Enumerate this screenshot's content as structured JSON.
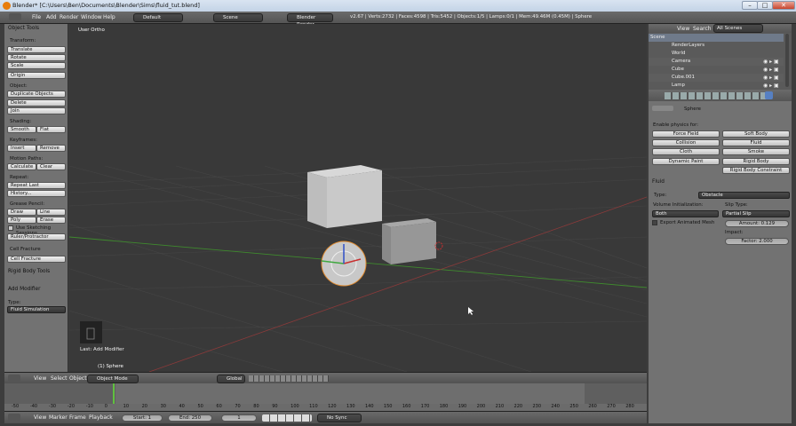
{
  "window": {
    "title": "Blender* [C:\\Users\\Ben\\Documents\\Blender\\Sims\\fluid_tut.blend]",
    "min": "–",
    "max": "□",
    "close": "✕"
  },
  "info_header": {
    "menus": [
      "File",
      "Add",
      "Render",
      "Window",
      "Help"
    ],
    "screen_layout": "Default",
    "scene": "Scene",
    "engine": "Blender Render",
    "stats": "v2.67 | Verts:2732 | Faces:4598 | Tris:5452 | Objects:1/5 | Lamps:0/1 | Mem:49.46M (0.45M) | Sphere"
  },
  "tool_shelf": {
    "title": "Object Tools",
    "transform_label": "Transform:",
    "translate": "Translate",
    "rotate": "Rotate",
    "scale": "Scale",
    "origin": "Origin",
    "object_label": "Object:",
    "duplicate": "Duplicate Objects",
    "delete": "Delete",
    "join": "Join",
    "shading_label": "Shading:",
    "smooth": "Smooth",
    "flat": "Flat",
    "keyframes_label": "Keyframes:",
    "insert": "Insert",
    "remove": "Remove",
    "motion_label": "Motion Paths:",
    "calculate": "Calculate",
    "clear": "Clear",
    "repeat_label": "Repeat:",
    "repeat_last": "Repeat Last",
    "history": "History...",
    "grease_label": "Grease Pencil:",
    "draw": "Draw",
    "line": "Line",
    "poly": "Poly",
    "erase": "Erase",
    "sketching": "Use Sketching Sessions",
    "ruler": "Ruler/Protractor",
    "cell_label": "Cell Fracture",
    "cell_btn": "Cell Fracture",
    "rigid_body": "Rigid Body Tools",
    "add_modifier": "Add Modifier",
    "type_label": "Type:",
    "type_value": "Fluid Simulation"
  },
  "viewport": {
    "label": "User Ortho",
    "last_op": "Last: Add Modifier",
    "active_obj": "(1) Sphere"
  },
  "view_header": {
    "menus": [
      "View",
      "Select",
      "Object"
    ],
    "mode": "Object Mode",
    "orientation": "Global"
  },
  "timeline": {
    "ticks": [
      "-50",
      "-40",
      "-30",
      "-20",
      "-10",
      "0",
      "10",
      "20",
      "30",
      "40",
      "50",
      "60",
      "70",
      "80",
      "90",
      "100",
      "110",
      "120",
      "130",
      "140",
      "150",
      "160",
      "170",
      "180",
      "190",
      "200",
      "210",
      "220",
      "230",
      "240",
      "250",
      "260",
      "270",
      "280"
    ],
    "menus": [
      "View",
      "Marker",
      "Frame",
      "Playback"
    ],
    "start": "Start: 1",
    "end": "End: 250",
    "current": "1",
    "sync": "No Sync"
  },
  "outliner": {
    "view": "View",
    "search": "Search",
    "scenes": "All Scenes",
    "items": [
      "Scene",
      "RenderLayers",
      "World",
      "Camera",
      "Cube",
      "Cube.001",
      "Lamp"
    ]
  },
  "properties": {
    "object_name": "Sphere",
    "enable_label": "Enable physics for:",
    "physics": [
      "Force Field",
      "Soft Body",
      "Collision",
      "Fluid",
      "Cloth",
      "Smoke",
      "Dynamic Paint",
      "Rigid Body",
      "",
      "Rigid Body Constraint"
    ],
    "fluid_title": "Fluid",
    "type_label": "Type:",
    "type_value": "Obstacle",
    "volume_label": "Volume Initialization:",
    "volume_value": "Both",
    "slip_label": "Slip Type:",
    "slip_value": "Partial Slip",
    "export_anim": "Export Animated Mesh",
    "amount": "Amount: 0.129",
    "impact_label": "Impact:",
    "factor": "Factor: 2.000"
  },
  "colors": {
    "accent": "#5680c2",
    "grid_x": "#8a3a3a",
    "grid_y": "#3f8a2e",
    "active_frame": "#60c040"
  }
}
